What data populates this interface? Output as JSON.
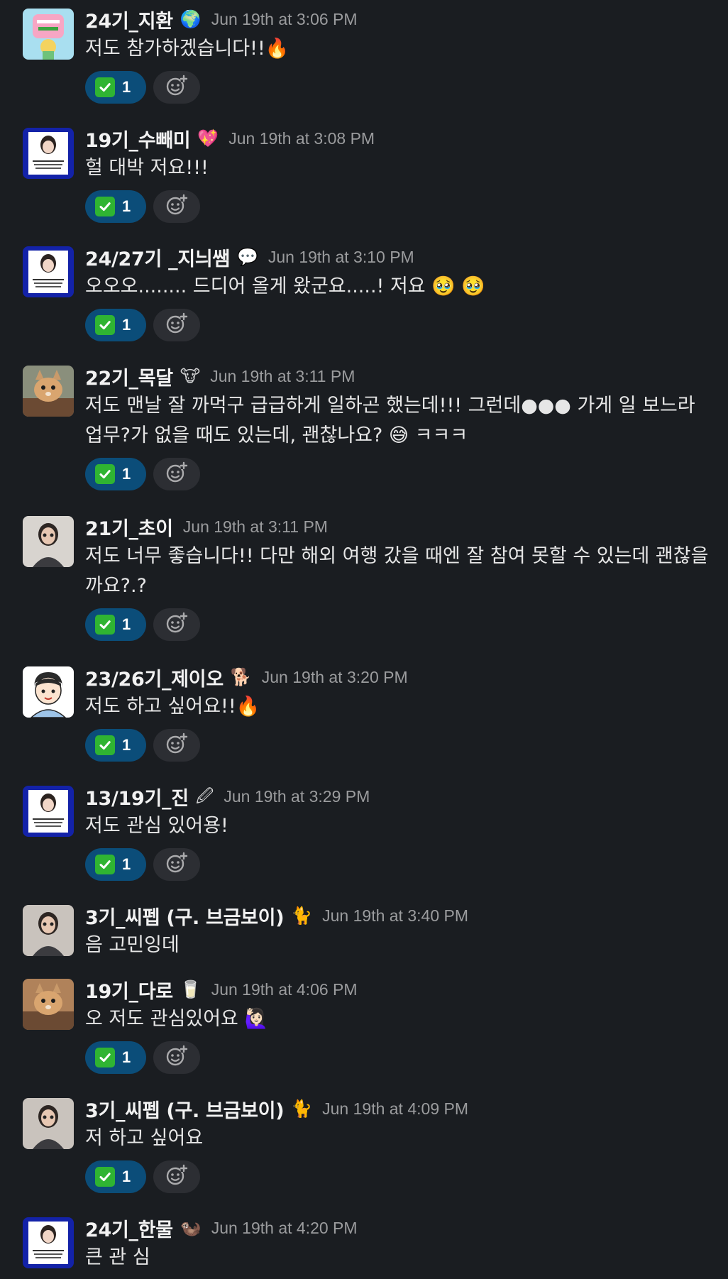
{
  "colors": {
    "background": "#1a1d21",
    "username": "#f2f2f2",
    "timestamp": "#9b9c9e",
    "reaction_pill": "#0b4d79",
    "check": "#2fb432",
    "add_reaction_pill": "#2c2e33"
  },
  "messages": [
    {
      "username": "24기_지환",
      "status_emoji": "🌍",
      "status_icon": "globe-icon",
      "timestamp": "Jun 19th at 3:06 PM",
      "text": "저도 참가하겠습니다!!🔥",
      "reaction": {
        "emoji": "white-check-mark-icon",
        "count": "1"
      },
      "avatar_icon": "avatar-pink-card-icon",
      "avatar_bg": "#a9dff0"
    },
    {
      "username": "19기_수빼미",
      "status_emoji": "💖",
      "status_icon": "sparkling-heart-icon",
      "timestamp": "Jun 19th at 3:08 PM",
      "text": "헐 대박 저요!!!",
      "reaction": {
        "emoji": "white-check-mark-icon",
        "count": "1"
      },
      "avatar_icon": "avatar-photo-card-icon",
      "avatar_bg": "#1322a8"
    },
    {
      "username": "24/27기 _지늬쌤",
      "status_emoji": "💬",
      "status_icon": "speech-bubble-icon",
      "timestamp": "Jun 19th at 3:10 PM",
      "text": "오오오........ 드디어 올게 왔군요.....! 저요 🥹 🥹",
      "reaction": {
        "emoji": "white-check-mark-icon",
        "count": "1"
      },
      "avatar_icon": "avatar-photo-card-icon",
      "avatar_bg": "#1322a8"
    },
    {
      "username": "22기_목달",
      "status_emoji": "🐮",
      "status_icon": "cow-face-icon",
      "timestamp": "Jun 19th at 3:11 PM",
      "text": "저도 맨날 잘 까먹구 급급하게 일하곤 했는데!!! 그런데●●● 가게 일 보느라 업무?가 없을 때도 있는데, 괜찮나요? 😅 ㅋㅋㅋ",
      "reaction": {
        "emoji": "white-check-mark-icon",
        "count": "1"
      },
      "avatar_icon": "avatar-cat-photo-icon",
      "avatar_bg": "#8a8f7c"
    },
    {
      "username": "21기_초이",
      "status_emoji": "",
      "status_icon": "",
      "timestamp": "Jun 19th at 3:11 PM",
      "text": "저도 너무 좋습니다!! 다만 해외 여행 갔을 때엔 잘 참여 못할 수 있는데 괜찮을까요?.?",
      "reaction": {
        "emoji": "white-check-mark-icon",
        "count": "1"
      },
      "avatar_icon": "avatar-person-photo-icon",
      "avatar_bg": "#d8d4cf"
    },
    {
      "username": "23/26기_제이오",
      "status_emoji": "🐕",
      "status_icon": "dog-icon",
      "timestamp": "Jun 19th at 3:20 PM",
      "text": "저도 하고 싶어요!!🔥",
      "reaction": {
        "emoji": "white-check-mark-icon",
        "count": "1"
      },
      "avatar_icon": "avatar-cartoon-boy-icon",
      "avatar_bg": "#ffffff"
    },
    {
      "username": "13/19기_진",
      "status_emoji": "🖉",
      "status_icon": "pen-icon",
      "timestamp": "Jun 19th at 3:29 PM",
      "text": "저도 관심 있어용!",
      "reaction": {
        "emoji": "white-check-mark-icon",
        "count": "1"
      },
      "avatar_icon": "avatar-photo-card-icon",
      "avatar_bg": "#1322a8"
    },
    {
      "username": "3기_씨펩 (구. 브금보이)",
      "status_emoji": "🐈",
      "status_icon": "cat-icon",
      "timestamp": "Jun 19th at 3:40 PM",
      "text": "음 고민잉데",
      "reaction": null,
      "avatar_icon": "avatar-person-photo-icon",
      "avatar_bg": "#c9c3bd"
    },
    {
      "username": "19기_다로",
      "status_emoji": "🥛",
      "status_icon": "milk-bottle-icon",
      "timestamp": "Jun 19th at 4:06 PM",
      "text": "오 저도 관심있어요 🙋🏻‍♀️",
      "reaction": {
        "emoji": "white-check-mark-icon",
        "count": "1"
      },
      "avatar_icon": "avatar-cat-photo-icon",
      "avatar_bg": "#b0825a"
    },
    {
      "username": "3기_씨펩 (구. 브금보이)",
      "status_emoji": "🐈",
      "status_icon": "cat-icon",
      "timestamp": "Jun 19th at 4:09 PM",
      "text": "저 하고 싶어요",
      "reaction": {
        "emoji": "white-check-mark-icon",
        "count": "1"
      },
      "avatar_icon": "avatar-person-photo-icon",
      "avatar_bg": "#c9c3bd"
    },
    {
      "username": "24기_한물",
      "status_emoji": "🦦",
      "status_icon": "otter-icon",
      "timestamp": "Jun 19th at 4:20 PM",
      "text": "큰 관 심",
      "reaction": null,
      "avatar_icon": "avatar-photo-card-icon",
      "avatar_bg": "#1322a8"
    }
  ]
}
